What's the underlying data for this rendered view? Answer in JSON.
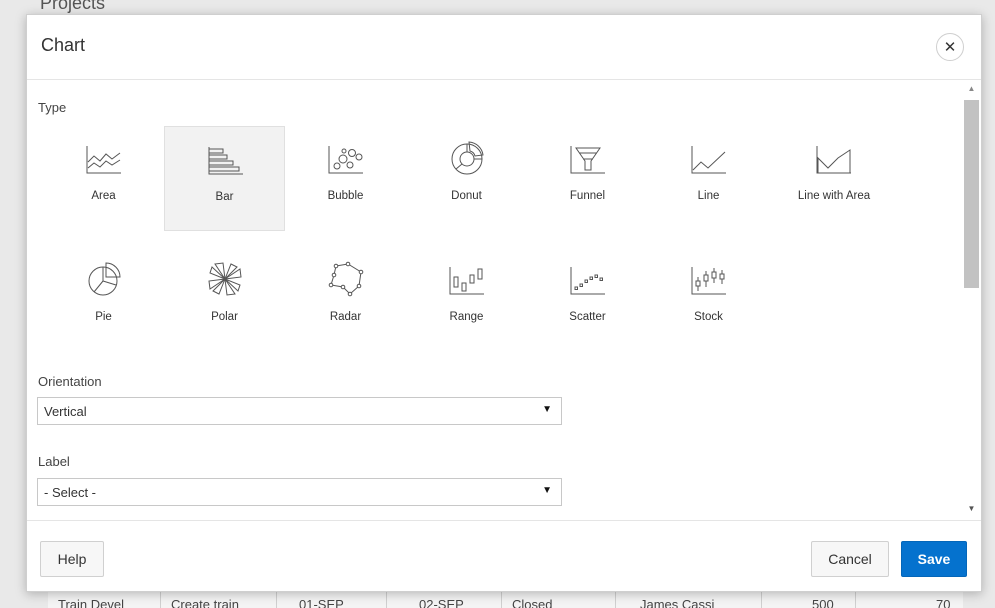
{
  "background": {
    "title": "Projects",
    "row": [
      "Train Devel",
      "Create train",
      "01-SEP",
      "02-SEP",
      "Closed",
      "James Cassi",
      "500",
      "70"
    ]
  },
  "dialog": {
    "title": "Chart",
    "close_glyph": "✕",
    "type_label": "Type",
    "types": [
      {
        "label": "Area",
        "icon": "area-chart-icon"
      },
      {
        "label": "Bar",
        "icon": "bar-chart-icon",
        "selected": true
      },
      {
        "label": "Bubble",
        "icon": "bubble-chart-icon"
      },
      {
        "label": "Donut",
        "icon": "donut-chart-icon"
      },
      {
        "label": "Funnel",
        "icon": "funnel-chart-icon"
      },
      {
        "label": "Line",
        "icon": "line-chart-icon"
      },
      {
        "label": "Line with Area",
        "icon": "line-area-chart-icon"
      },
      {
        "label": "Pie",
        "icon": "pie-chart-icon"
      },
      {
        "label": "Polar",
        "icon": "polar-chart-icon"
      },
      {
        "label": "Radar",
        "icon": "radar-chart-icon"
      },
      {
        "label": "Range",
        "icon": "range-chart-icon"
      },
      {
        "label": "Scatter",
        "icon": "scatter-chart-icon"
      },
      {
        "label": "Stock",
        "icon": "stock-chart-icon"
      }
    ],
    "orientation": {
      "label": "Orientation",
      "value": "Vertical"
    },
    "label_field": {
      "label": "Label",
      "value": "- Select -"
    },
    "caret_glyph": "▼",
    "scroll_up_glyph": "▲",
    "scroll_down_glyph": "▼",
    "buttons": {
      "help": "Help",
      "cancel": "Cancel",
      "save": "Save"
    },
    "colors": {
      "primary": "#0572ce",
      "selected_bg": "#f2f2f2"
    }
  }
}
